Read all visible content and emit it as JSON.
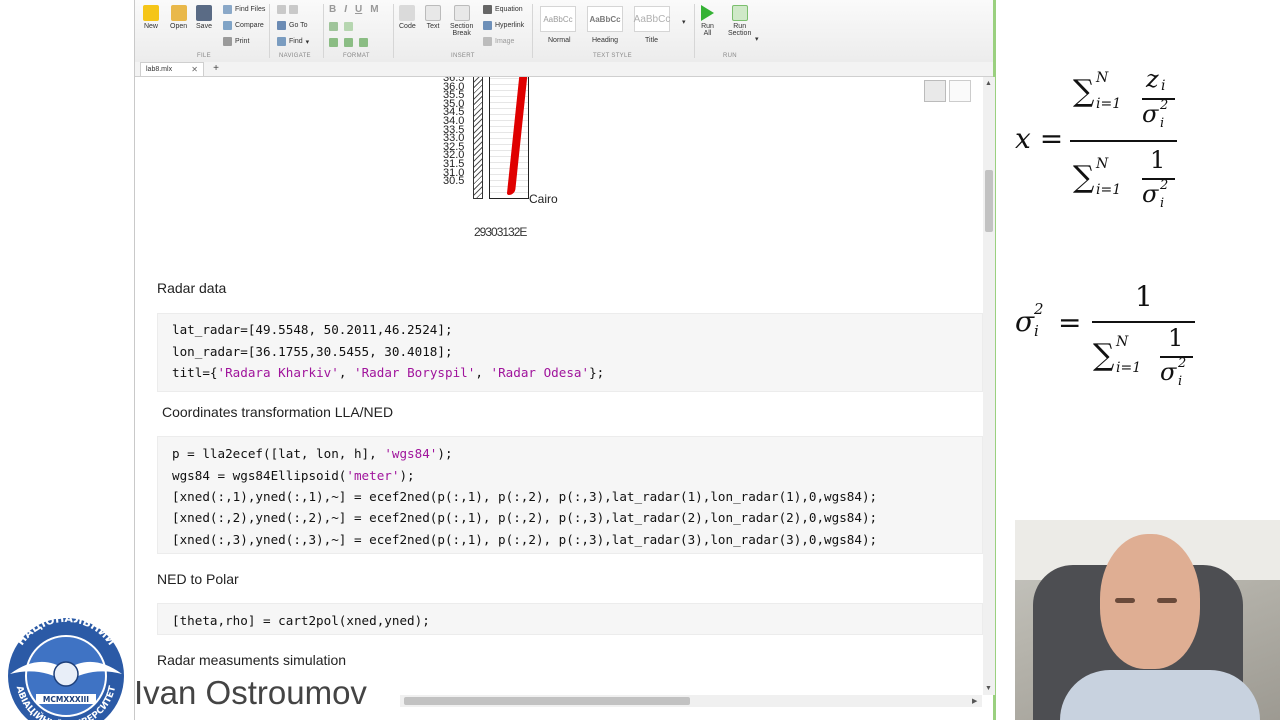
{
  "ribbon": {
    "file": {
      "label": "FILE",
      "new": "New",
      "open": "Open",
      "save": "Save",
      "find_files": "Find Files",
      "compare": "Compare",
      "print": "Print"
    },
    "navigate": {
      "label": "NAVIGATE",
      "go_to": "Go To",
      "find": "Find"
    },
    "format": {
      "label": "FORMAT",
      "bold": "B",
      "italic": "I",
      "underline": "U",
      "mono": "M"
    },
    "insert": {
      "label": "INSERT",
      "code": "Code",
      "text": "Text",
      "section_break_1": "Section",
      "section_break_2": "Break",
      "equation": "Equation",
      "hyperlink": "Hyperlink",
      "image": "Image"
    },
    "text_style": {
      "label": "TEXT STYLE",
      "sample": "AaBbCc",
      "normal": "Normal",
      "heading": "Heading",
      "title": "Title"
    },
    "run": {
      "label": "RUN",
      "run_all_1": "Run",
      "run_all_2": "All",
      "run_section_1": "Run",
      "run_section_2": "Section"
    }
  },
  "tabs": {
    "active": "lab8.mlx",
    "add": "+"
  },
  "plot": {
    "y_ticks": [
      "36.5",
      "36.0",
      "35.5",
      "35.0",
      "34.5",
      "34.0",
      "33.5",
      "33.0",
      "32.5",
      "32.0",
      "31.5",
      "31.0",
      "30.5"
    ],
    "city_label": "Cairo",
    "x_ticks": "29303132E"
  },
  "sections": {
    "radar_data": {
      "heading": "Radar data",
      "lines": [
        {
          "plain": "lat_radar=[49.5548, 50.2011,46.2524];"
        },
        {
          "plain": "lon_radar=[36.1755,30.5455, 30.4018];"
        },
        {
          "pre": "titl={",
          "s1": "'Radara Kharkiv'",
          "m1": ", ",
          "s2": "'Radar Boryspil'",
          "m2": ", ",
          "s3": "'Radar Odesa'",
          "post": "};"
        }
      ]
    },
    "transform": {
      "heading": "Coordinates transformation LLA/NED",
      "lines": [
        {
          "pre": "p = lla2ecef([lat, lon, h], ",
          "str": "'wgs84'",
          "post": ");"
        },
        {
          "pre": "wgs84 = wgs84Ellipsoid(",
          "str": "'meter'",
          "post": ");"
        },
        {
          "plain": "[xned(:,1),yned(:,1),~] = ecef2ned(p(:,1), p(:,2), p(:,3),lat_radar(1),lon_radar(1),0,wgs84);"
        },
        {
          "plain": "[xned(:,2),yned(:,2),~] = ecef2ned(p(:,1), p(:,2), p(:,3),lat_radar(2),lon_radar(2),0,wgs84);"
        },
        {
          "plain": "[xned(:,3),yned(:,3),~] = ecef2ned(p(:,1), p(:,2), p(:,3),lat_radar(3),lon_radar(3),0,wgs84);"
        }
      ]
    },
    "ned_polar": {
      "heading": "NED to Polar",
      "lines": [
        {
          "plain": "[theta,rho] = cart2pol(xned,yned);"
        }
      ]
    },
    "simulation": {
      "heading": "Radar measuments simulation"
    }
  },
  "formulas": {
    "f1": {
      "lhs": "x =",
      "sum": "∑",
      "sup": "N",
      "sub": "i=1",
      "num": "z",
      "num_sub": "i",
      "den": "σ",
      "den_sup": "2",
      "den_sub": "i",
      "one": "1"
    },
    "f2": {
      "lhs": "σ",
      "lhs_sup": "2",
      "lhs_sub": "i",
      "eq": "=",
      "one": "1"
    }
  },
  "presenter": {
    "name": "Ivan Ostroumov"
  },
  "logo": {
    "top_text": "НАЦІОНАЛЬНИЙ",
    "bottom_text": "АВІАЦІЙНИЙ УНІВЕРСИТЕТ",
    "year": "MCMXXXIII"
  },
  "colors": {
    "string": "#a0149c",
    "plot_line": "#e00000",
    "window_accent": "#9ad07f"
  }
}
